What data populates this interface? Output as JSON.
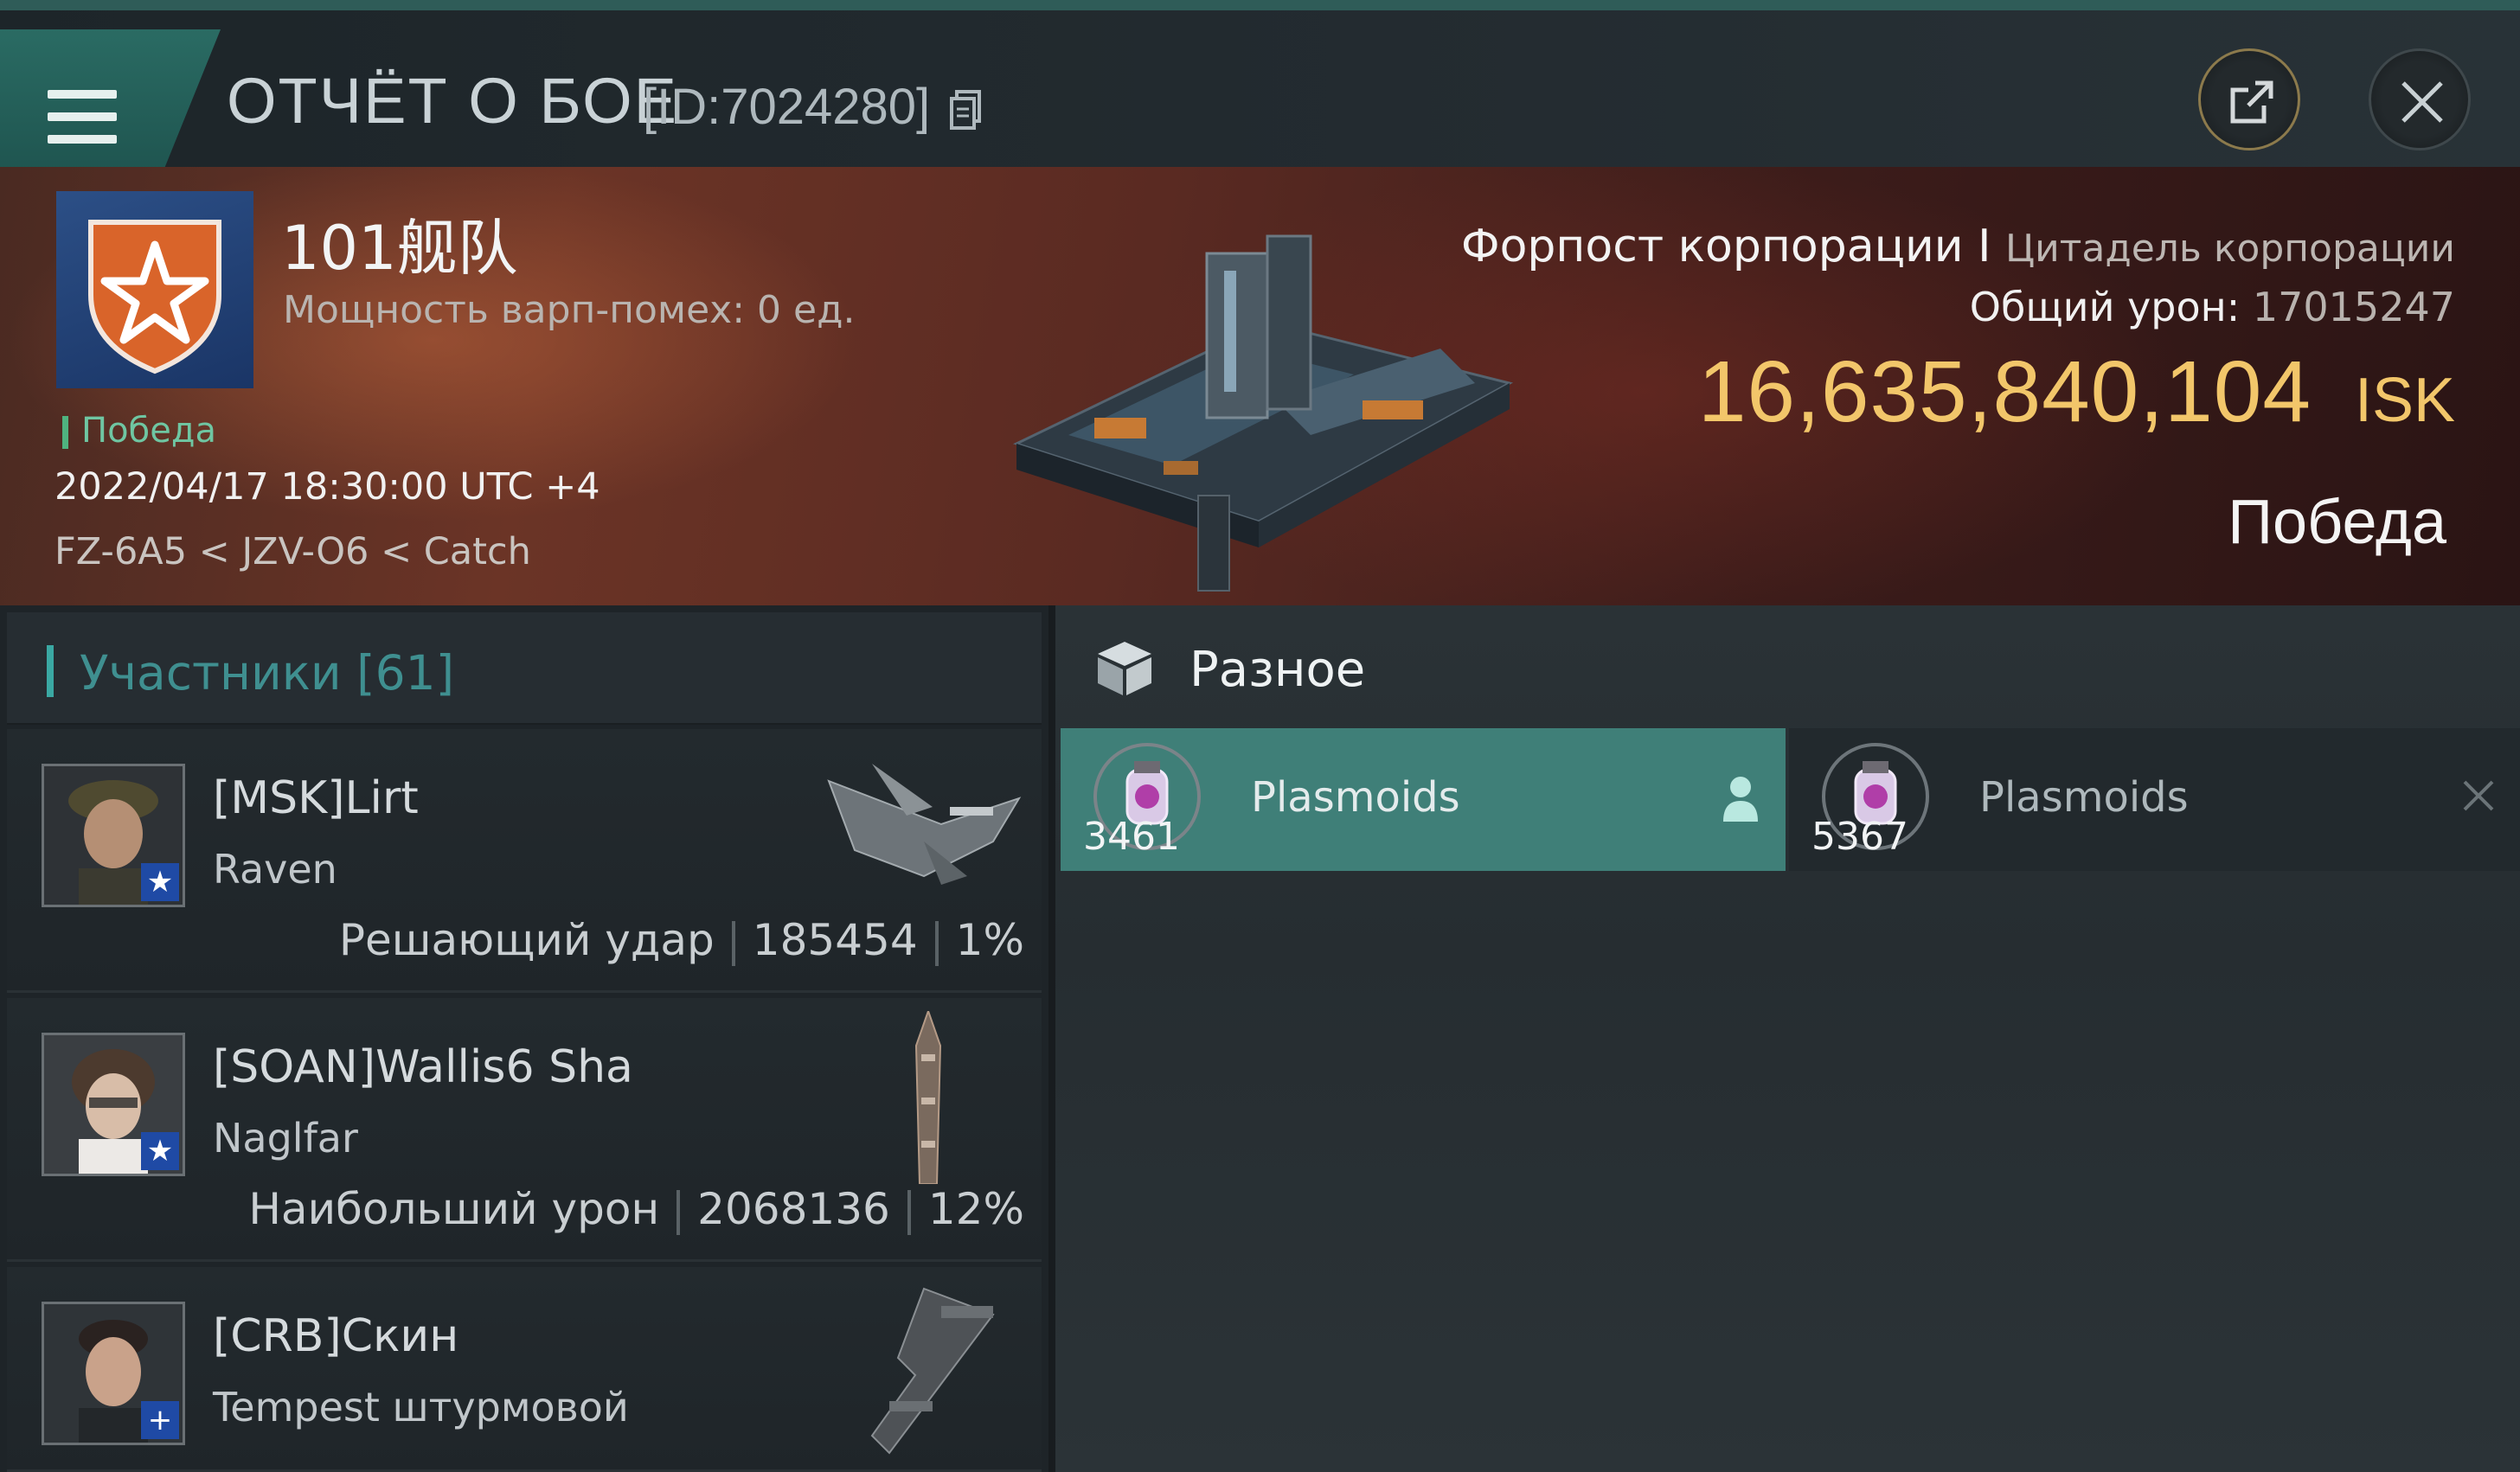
{
  "header": {
    "title": "ОТЧЁТ О БОЕ",
    "report_id": "[ID:7024280]",
    "menu_icon": "hamburger-menu-icon",
    "copy_icon": "copy-icon",
    "share_icon": "share-external-icon",
    "close_icon": "close-icon"
  },
  "battle": {
    "corp_name": "101舰队",
    "warp_strength": "Мощность варп-помех: 0 ед.",
    "result_tag": "Победа",
    "datetime": "2022/04/17 18:30:00 UTC +4",
    "location": "FZ-6A5 < JZV-O6 < Catch",
    "target_type": "Форпост корпорации",
    "separator": "I",
    "target_subtype": "Цитадель корпорации",
    "total_damage_label": "Общий урон:",
    "total_damage_value": "17015247",
    "isk_value": "16,635,840,104",
    "isk_unit": "ISK",
    "outcome": "Победа"
  },
  "participants": {
    "title": "Участники [61]",
    "rows": [
      {
        "pilot": "[MSK]Lirt",
        "ship": "Raven",
        "role": "Решающий удар",
        "damage": "185454",
        "percent": "1%",
        "badge": "★"
      },
      {
        "pilot": "[SOAN]Wallis6 Sha",
        "ship": "Naglfar",
        "role": "Наибольший урон",
        "damage": "2068136",
        "percent": "12%",
        "badge": "★"
      },
      {
        "pilot": "[CRB]Скин",
        "ship": "Tempest штурмовой",
        "role": "",
        "damage": "",
        "percent": "",
        "badge": "+"
      }
    ]
  },
  "items": {
    "title": "Разное",
    "cards": [
      {
        "name": "Plasmoids",
        "qty": "3461",
        "state": "selected"
      },
      {
        "name": "Plasmoids",
        "qty": "5367",
        "state": "destroyed"
      }
    ]
  },
  "colors": {
    "accent_teal": "#3f7f78",
    "isk_gold": "#f2c66a",
    "victory_green": "#4fb37f",
    "corp_blue": "#1f4aa5",
    "corp_orange": "#d9642a"
  }
}
